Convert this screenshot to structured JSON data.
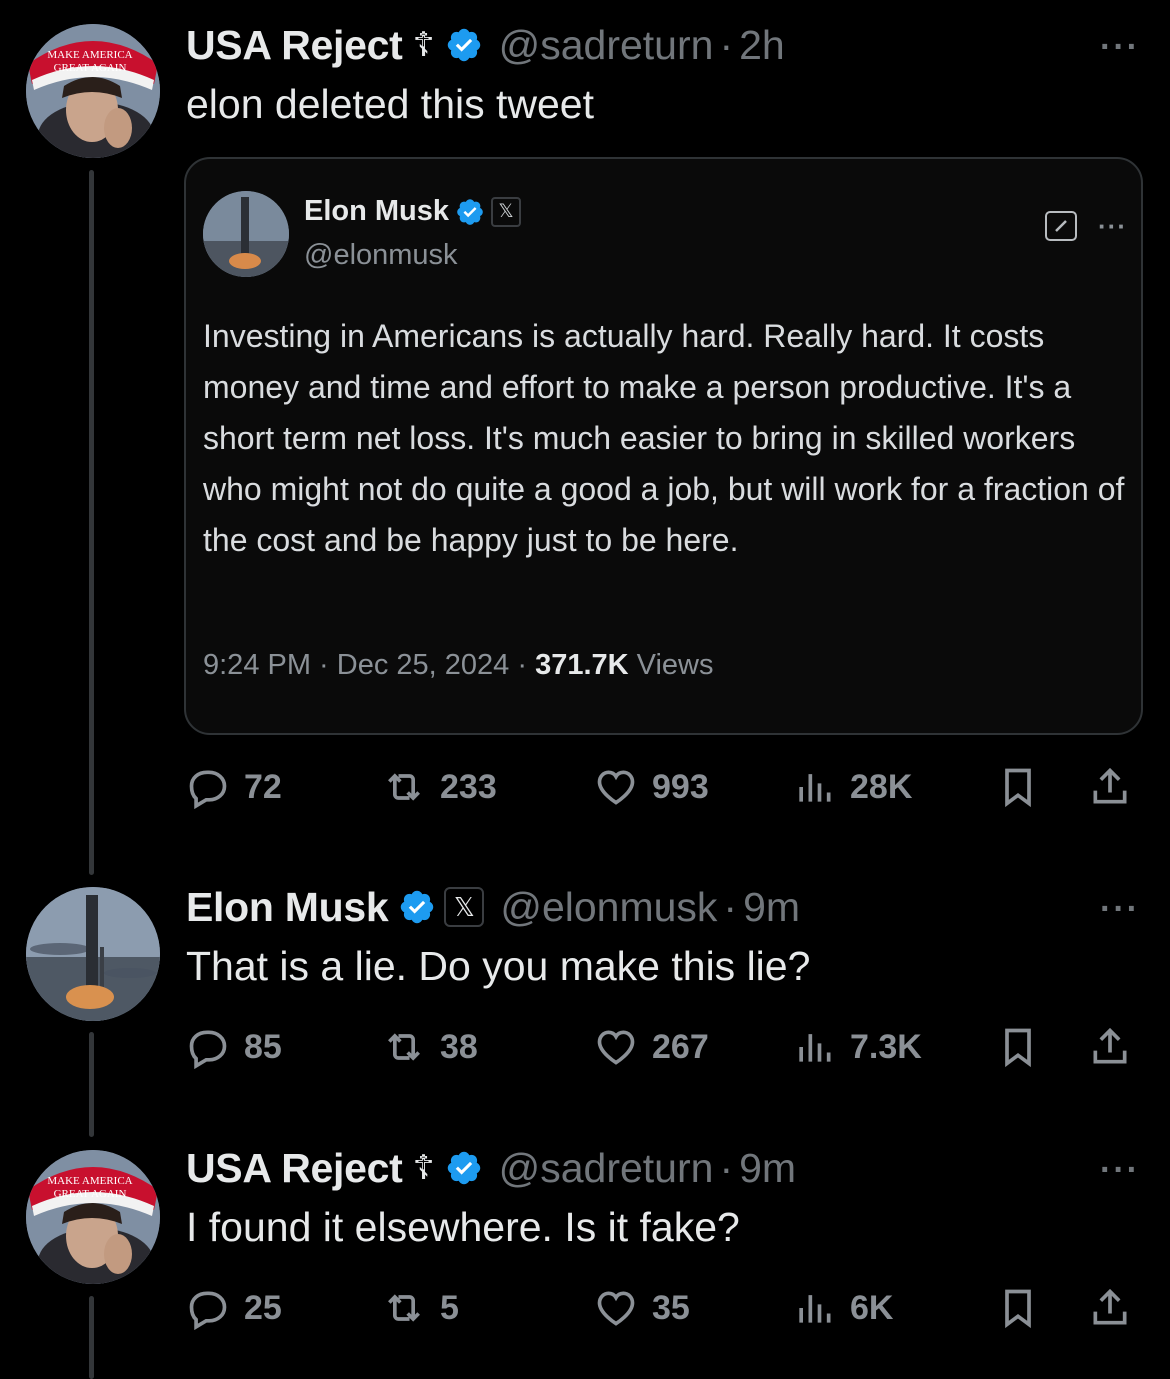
{
  "colors": {
    "background": "#000000",
    "text": "#e7e9ea",
    "muted": "#71767b",
    "verified_blue": "#1d9bf0"
  },
  "tweets": [
    {
      "name": "USA Reject",
      "name_symbol": "☦",
      "handle": "@sadreturn",
      "separator": "·",
      "time": "2h",
      "avatar_text": [
        "MAKE AMERICA",
        "GREAT AGAIN"
      ],
      "text": "elon deleted this tweet",
      "quote": {
        "name": "Elon Musk",
        "badge": "𝕏",
        "handle": "@elonmusk",
        "text": "Investing in Americans is actually hard. Really hard. It costs money and time and effort to make a person productive. It's a short term net loss. It's much easier to bring in skilled workers who might not do quite a good a job, but will work for a fraction of the cost and be happy just to be here.",
        "meta_time": "9:24 PM · Dec 25, 2024 · ",
        "meta_views_count": "371.7K",
        "meta_views_label": " Views"
      },
      "actions": {
        "replies": "72",
        "reposts": "233",
        "likes": "993",
        "views": "28K"
      }
    },
    {
      "name": "Elon Musk",
      "badge": "𝕏",
      "handle": "@elonmusk",
      "separator": "·",
      "time": "9m",
      "text": "That is a lie. Do you make this lie?",
      "actions": {
        "replies": "85",
        "reposts": "38",
        "likes": "267",
        "views": "7.3K"
      }
    },
    {
      "name": "USA Reject",
      "name_symbol": "☦",
      "handle": "@sadreturn",
      "separator": "·",
      "time": "9m",
      "avatar_text": [
        "MAKE AMERICA",
        "GREAT AGAIN"
      ],
      "text": "I found it elsewhere. Is it fake?",
      "actions": {
        "replies": "25",
        "reposts": "5",
        "likes": "35",
        "views": "6K"
      }
    }
  ],
  "more_label": "···",
  "icons": [
    "reply-icon",
    "repost-icon",
    "like-icon",
    "views-icon",
    "bookmark-icon",
    "share-icon",
    "verified-icon",
    "more-icon"
  ]
}
